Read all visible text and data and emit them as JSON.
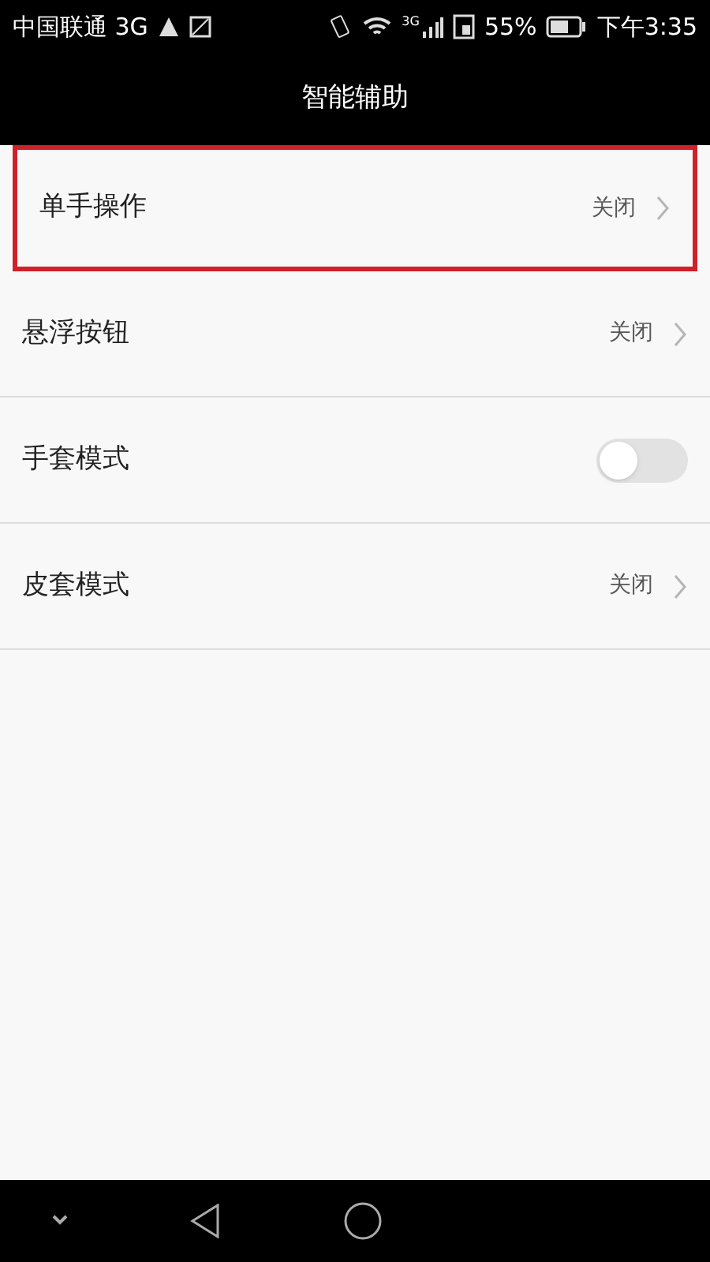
{
  "status_bar": {
    "carrier": "中国联通 3G",
    "network_label": "3G",
    "battery": "55%",
    "time": "下午3:35"
  },
  "header": {
    "title": "智能辅助"
  },
  "rows": [
    {
      "kind": "link",
      "label": "单手操作",
      "value": "关闭",
      "highlighted": true
    },
    {
      "kind": "link",
      "label": "悬浮按钮",
      "value": "关闭",
      "highlighted": false
    },
    {
      "kind": "toggle",
      "label": "手套模式",
      "on": false,
      "highlighted": false
    },
    {
      "kind": "link",
      "label": "皮套模式",
      "value": "关闭",
      "highlighted": false
    }
  ]
}
